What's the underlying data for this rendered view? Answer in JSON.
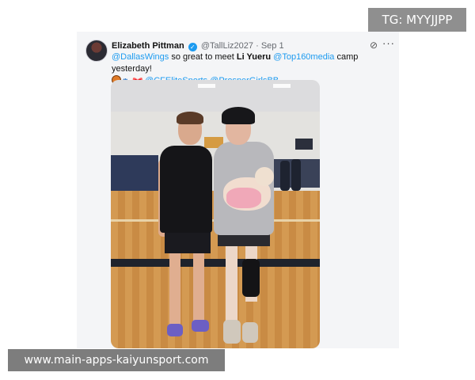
{
  "watermark_top": "TG: MYYJJPP",
  "watermark_bottom": "www.main-apps-kaiyunsport.com",
  "tweet": {
    "author_name": "Elizabeth Pittman",
    "handle": "@TallLiz2027",
    "separator": " · ",
    "date": "Sep 1",
    "more_label": "···",
    "text": {
      "mention1": "@DallasWings",
      "part1": " so great to meet ",
      "bold_name": "Li Yueru",
      "space": " ",
      "mention2": "@Top160media",
      "part2": " camp yesterday!",
      "mention3": "@CFEliteSports",
      "mention4": "@ProsperGirlsBB"
    },
    "emojis": [
      "basketball",
      "paw-prints",
      "ribbon-bow"
    ]
  },
  "colors": {
    "link": "#1d9bf0",
    "verified": "#1d9bf0"
  }
}
